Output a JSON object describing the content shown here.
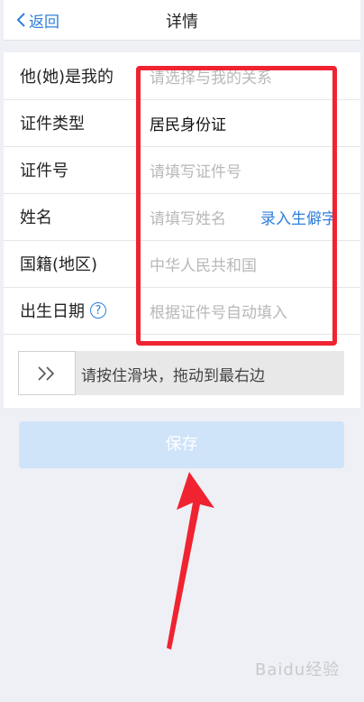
{
  "header": {
    "back_label": "返回",
    "title": "详情"
  },
  "form": {
    "rows": [
      {
        "label": "他(她)是我的",
        "value": "请选择与我的关系",
        "state": "placeholder"
      },
      {
        "label": "证件类型",
        "value": "居民身份证",
        "state": "filled"
      },
      {
        "label": "证件号",
        "value": "请填写证件号",
        "state": "placeholder"
      },
      {
        "label": "姓名",
        "value": "请填写姓名",
        "state": "placeholder",
        "link": "录入生僻字"
      },
      {
        "label": "国籍(地区)",
        "value": "中华人民共和国",
        "state": "placeholder"
      },
      {
        "label": "出生日期",
        "value": "根据证件号自动填入",
        "state": "placeholder",
        "info_icon": "?"
      }
    ]
  },
  "slider": {
    "text": "请按住滑块，拖动到最右边",
    "handle_icon": "double-chevron-right-icon"
  },
  "save_button": {
    "label": "保存"
  },
  "watermark": {
    "text": "Baidu经验"
  },
  "colors": {
    "accent": "#2f7fdb",
    "highlight": "#f02330",
    "save_bg": "#cfe3f9"
  }
}
